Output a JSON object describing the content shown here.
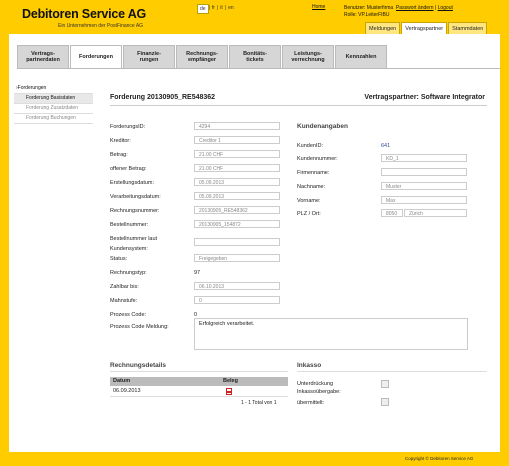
{
  "header": {
    "logo": "Debitoren Service AG",
    "tagline": "Ein Unternehmen der PostFinance AG",
    "languages": [
      "de",
      "fr",
      "it",
      "en"
    ],
    "home_link": "Home",
    "user_label": "Benutzer: Musterfirma",
    "role_label": "Rolle: VP.LeiterFIBU",
    "password_link": "Passwort ändern",
    "logout_link": "Logout",
    "top_tabs": [
      "Meldungen",
      "Vertragspartner",
      "Stammdaten"
    ]
  },
  "nav_tabs": [
    {
      "label": "Vertrags-\npartnerdaten"
    },
    {
      "label": "Forderungen"
    },
    {
      "label": "Finanzie-\nrungen"
    },
    {
      "label": "Rechnungs-\nempfänger"
    },
    {
      "label": "Bonitäts-\ntickets"
    },
    {
      "label": "Leistungs-\nverrechnung"
    },
    {
      "label": "Kennzahlen"
    }
  ],
  "sidebar": {
    "root": "Forderungen",
    "items": [
      "Forderung Basisdaten",
      "Forderung Zusatzdaten",
      "Forderung Buchungen"
    ]
  },
  "detail": {
    "title": "Forderung 20130905_RE548362",
    "partner": "Vertragspartner: Software Integrator",
    "fields": {
      "forderungs_id": {
        "label": "ForderungsID:",
        "value": "4294"
      },
      "kreditor": {
        "label": "Kreditor:",
        "value": "Creditor 1"
      },
      "betrag": {
        "label": "Betrag:",
        "value": "21.00 CHF"
      },
      "offener_betrag": {
        "label": "offener Betrag:",
        "value": "21.00 CHF"
      },
      "erstellungsdatum": {
        "label": "Erstellungsdatum:",
        "value": "05.09.2013"
      },
      "verarbeitungsdatum": {
        "label": "Verarbeitungsdatum:",
        "value": "05.09.2013"
      },
      "rechnungsnummer": {
        "label": "Rechnungsnummer:",
        "value": "20130905_RE548362"
      },
      "bestellnummer": {
        "label": "Bestellnummer:",
        "value": "20130905_154872"
      },
      "bestellnummer_kunde": {
        "label1": "Bestellnummer laut",
        "label2": "Kundensystem:",
        "value": ""
      },
      "status": {
        "label": "Status:",
        "value": "Freigegeben"
      },
      "rechnungstyp": {
        "label": "Rechnungstyp:",
        "value": "97"
      },
      "zahlbar_bis": {
        "label": "Zahlbar bis:",
        "value": "06.10.2013"
      },
      "mahnstufe": {
        "label": "Mahnstufe:",
        "value": "0"
      },
      "prozess_code": {
        "label": "Prozess Code:",
        "value": "0"
      },
      "prozess_meldung": {
        "label": "Prozess Code Meldung:",
        "value": "Erfolgreich verarbeitet."
      }
    },
    "kunde": {
      "title": "Kundenangaben",
      "kunden_id": {
        "label": "KundenID:",
        "value": "641"
      },
      "kundennummer": {
        "label": "Kundennummer:",
        "value": "KD_1"
      },
      "firmenname": {
        "label": "Firmenname:",
        "value": ""
      },
      "nachname": {
        "label": "Nachname:",
        "value": "Muster"
      },
      "vorname": {
        "label": "Vorname:",
        "value": "Max"
      },
      "plz_ort": {
        "label": "PLZ / Ort:",
        "plz": "8050",
        "ort": "Zürich"
      }
    },
    "rechnungsdetails": {
      "title": "Rechnungsdetails",
      "columns": [
        "Datum",
        "Beleg"
      ],
      "rows": [
        {
          "datum": "06.09.2013",
          "beleg": "pdf-icon"
        }
      ],
      "pager": "1 - 1 Total von 1"
    },
    "inkasso": {
      "title": "Inkasso",
      "unterdrueckung1": "Unterdrückung",
      "unterdrueckung2": "Inkassoübergabe:",
      "uebermittelt": "übermittelt:"
    }
  },
  "footer": {
    "copyright": "Copyright © Debitoren Service AG"
  },
  "colors": {
    "brand": "#FFCC00",
    "pdf": "#cc2222"
  }
}
